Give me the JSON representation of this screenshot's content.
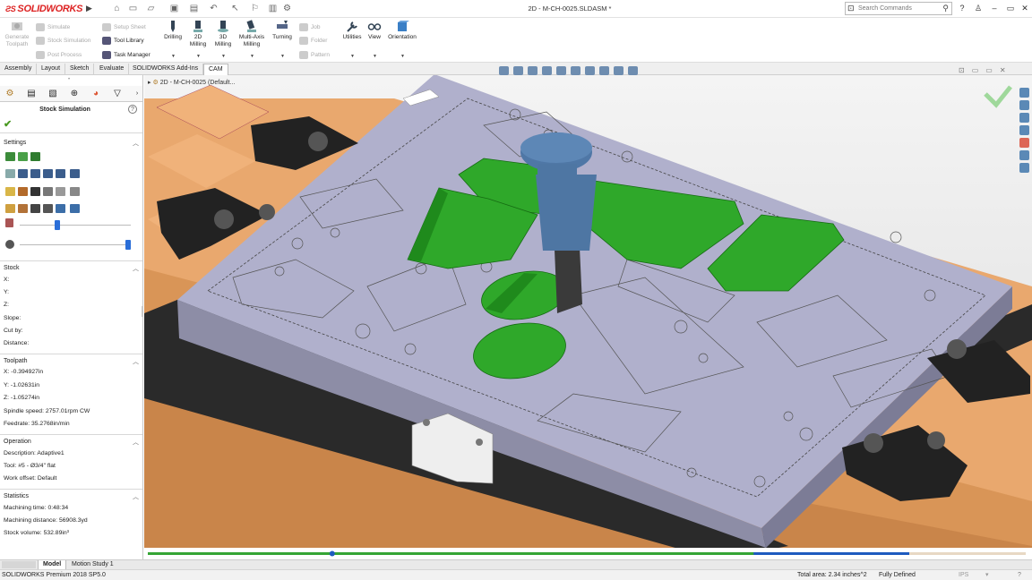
{
  "app": {
    "brand": "SOLIDWORKS",
    "document_title": "2D - M-CH-0025.SLDASM *",
    "search_placeholder": "Search Commands"
  },
  "command_manager": {
    "generate_toolpath": "Generate Toolpath",
    "simulate": "Simulate",
    "stock_simulation": "Stock Simulation",
    "post_process": "Post Process",
    "setup_sheet": "Setup Sheet",
    "tool_library": "Tool Library",
    "task_manager": "Task Manager",
    "drilling": "Drilling",
    "milling_2d": "2D Milling",
    "milling_3d": "3D Milling",
    "multi_axis_milling": "Multi-Axis Milling",
    "turning": "Turning",
    "job": "Job",
    "folder": "Folder",
    "pattern": "Pattern",
    "utilities": "Utilities",
    "view": "View",
    "orientation": "Orientation"
  },
  "tabs": [
    "Assembly",
    "Layout",
    "Sketch",
    "Evaluate",
    "SOLIDWORKS Add-Ins",
    "CAM"
  ],
  "breadcrumb": "2D - M-CH-0025  (Default...",
  "panel": {
    "title": "Stock Simulation",
    "settings": {
      "header": "Settings"
    },
    "stock": {
      "header": "Stock",
      "x": "X:",
      "y": "Y:",
      "z": "Z:",
      "slope": "Slope:",
      "cut_by": "Cut by:",
      "distance": "Distance:"
    },
    "toolpath": {
      "header": "Toolpath",
      "x": "X: -0.394927in",
      "y": "Y: -1.02631in",
      "z": "Z: -1.05274in",
      "spindle": "Spindle speed: 2757.01rpm CW",
      "feedrate": "Feedrate: 35.2768in/min"
    },
    "operation": {
      "header": "Operation",
      "description": "Description: Adaptive1",
      "tool": "Tool: #5 - Ø3/4\" flat",
      "work_offset": "Work offset: Default"
    },
    "statistics": {
      "header": "Statistics",
      "machining_time": "Machining time: 0:48:34",
      "machining_distance": "Machining distance: 56908.3yd",
      "stock_volume": "Stock volume: 532.89in³"
    },
    "sliders": {
      "tool_transparency": 0.33,
      "speed": 1.0
    }
  },
  "timeline": {
    "progress": 0.69,
    "marker": 0.21
  },
  "bottom_tabs": [
    "Model",
    "Motion Study 1"
  ],
  "status": {
    "version": "SOLIDWORKS Premium 2018 SP5.0",
    "total_area": "Total area: 2.34 inches^2",
    "state": "Fully Defined",
    "units": "IPS"
  },
  "colors": {
    "accent": "#2a6ed8",
    "green_cut": "#2fa82a",
    "stock": "#a9a9c4",
    "fixture_wood": "#e7a870"
  }
}
